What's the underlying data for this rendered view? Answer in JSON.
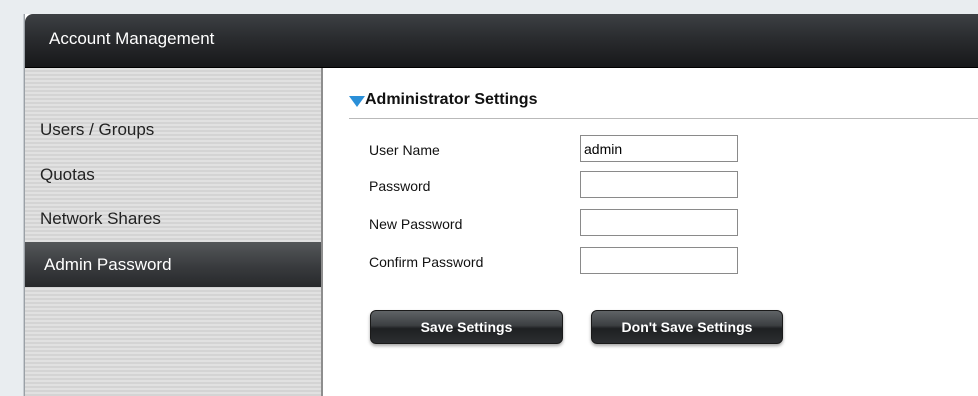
{
  "window": {
    "title": "Account Management"
  },
  "sidebar": {
    "items": [
      {
        "label": "Users / Groups"
      },
      {
        "label": "Quotas"
      },
      {
        "label": "Network Shares"
      },
      {
        "label": "Admin Password",
        "active": true
      }
    ]
  },
  "main": {
    "section_title": "Administrator Settings",
    "fields": [
      {
        "label": "User Name",
        "value": "admin"
      },
      {
        "label": "Password",
        "value": ""
      },
      {
        "label": "New Password",
        "value": ""
      },
      {
        "label": "Confirm Password",
        "value": ""
      }
    ],
    "buttons": {
      "save": "Save Settings",
      "dont_save": "Don't Save Settings"
    }
  },
  "colors": {
    "accent_triangle": "#2a8fd8",
    "titlebar": "#2a2c2f",
    "active_item": "#393b3e"
  }
}
